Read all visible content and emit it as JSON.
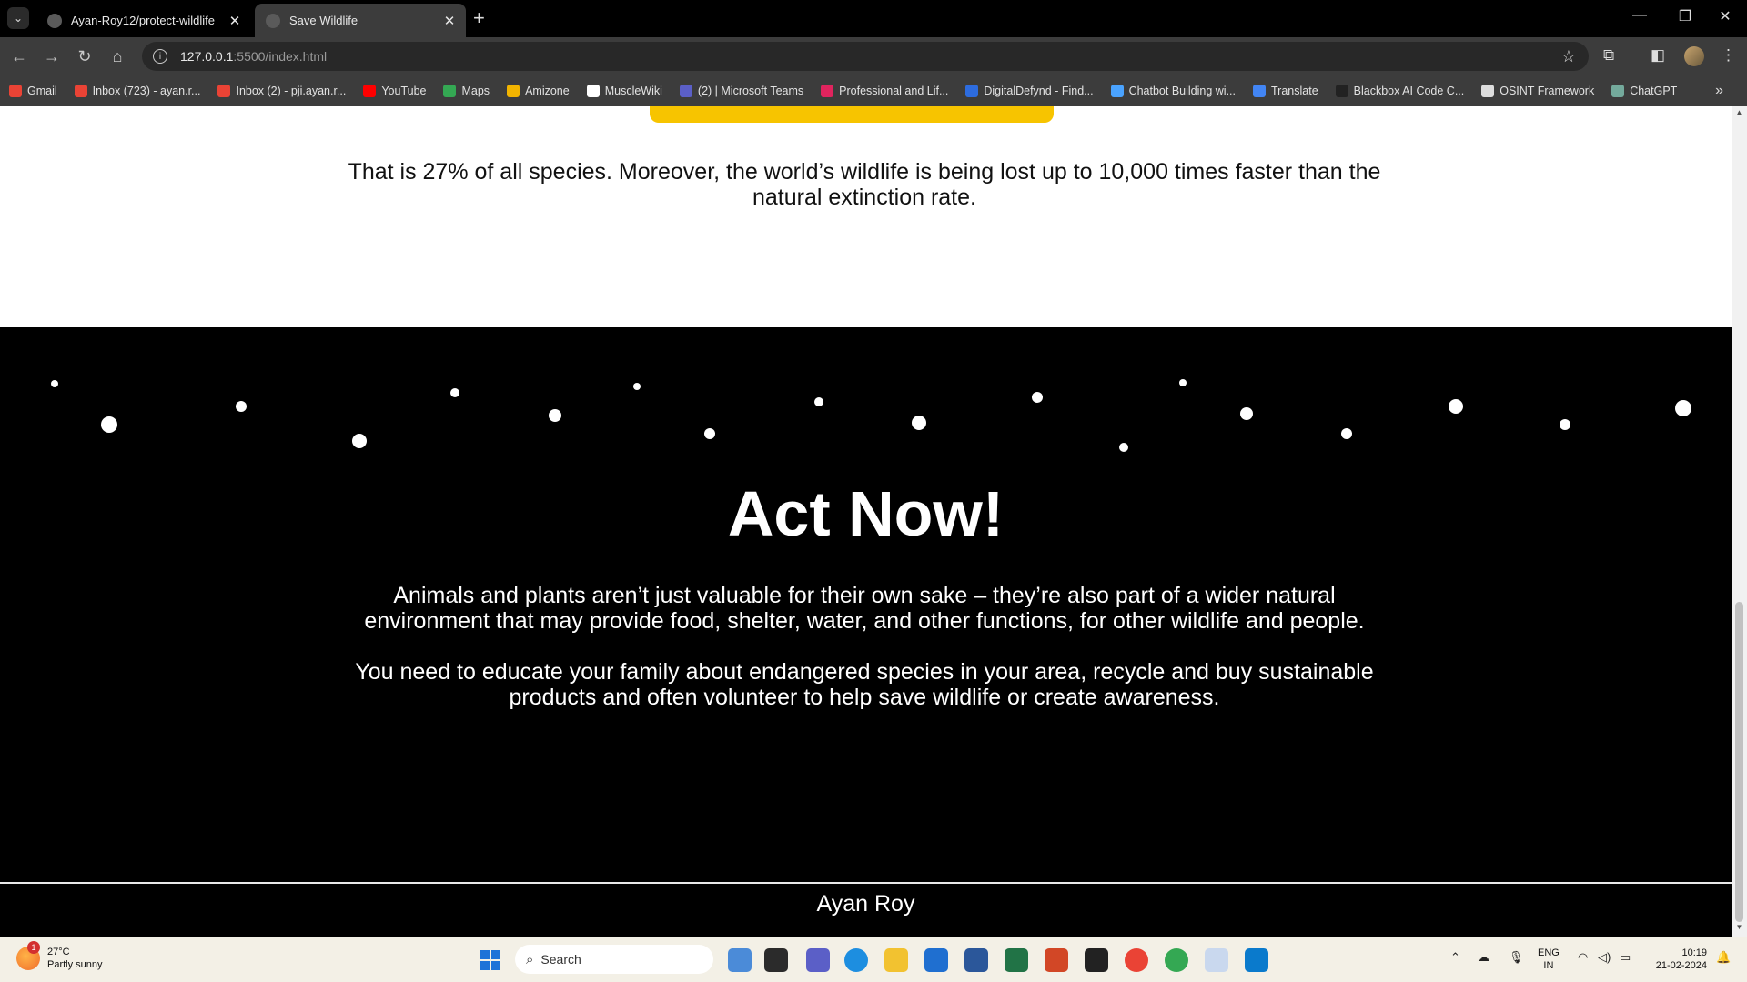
{
  "browser": {
    "tabs": [
      {
        "title": "Ayan-Roy12/protect-wildlife",
        "active": false
      },
      {
        "title": "Save Wildlife",
        "active": true
      }
    ],
    "new_tab_symbol": "+",
    "close_symbol": "✕",
    "address": {
      "host": "127.0.0.1",
      "rest": ":5500/index.html"
    },
    "bookmarks": [
      {
        "label": "Gmail",
        "color": "#ea4335"
      },
      {
        "label": "Inbox (723) - ayan.r...",
        "color": "#ea4335"
      },
      {
        "label": "Inbox (2) - pji.ayan.r...",
        "color": "#ea4335"
      },
      {
        "label": "YouTube",
        "color": "#ff0000"
      },
      {
        "label": "Maps",
        "color": "#34a853"
      },
      {
        "label": "Amizone",
        "color": "#f2b400"
      },
      {
        "label": "MuscleWiki",
        "color": "#ffffff"
      },
      {
        "label": "(2) | Microsoft Teams",
        "color": "#5b5fc7"
      },
      {
        "label": "Professional and Lif...",
        "color": "#e0245e"
      },
      {
        "label": "DigitalDefynd - Find...",
        "color": "#2d6cdf"
      },
      {
        "label": "Chatbot Building wi...",
        "color": "#4aa3ff"
      },
      {
        "label": "Translate",
        "color": "#4285f4"
      },
      {
        "label": "Blackbox AI Code C...",
        "color": "#222222"
      },
      {
        "label": "OSINT Framework",
        "color": "#dddddd"
      },
      {
        "label": "ChatGPT",
        "color": "#74aa9c"
      }
    ]
  },
  "page": {
    "stat_text": "That is 27% of all species. Moreover, the world’s wildlife is being lost up to 10,000 times faster than the natural extinction rate.",
    "act_title": "Act Now!",
    "paragraph1": "Animals and plants aren’t just valuable for their own sake – they’re also part of a wider natural environment that may provide food, shelter, water, and other functions, for other wildlife and people.",
    "paragraph2": "You need to educate your family about endangered species in your area, recycle and buy sustainable products and often volunteer to help save wildlife or create awareness.",
    "footer_name": "Ayan Roy",
    "accent_yellow": "#f7c400"
  },
  "taskbar": {
    "weather_temp": "27°C",
    "weather_desc": "Partly sunny",
    "weather_badge": "1",
    "search_label": "Search",
    "lang_line1": "ENG",
    "lang_line2": "IN",
    "time": "10:19",
    "date": "21-02-2024"
  }
}
